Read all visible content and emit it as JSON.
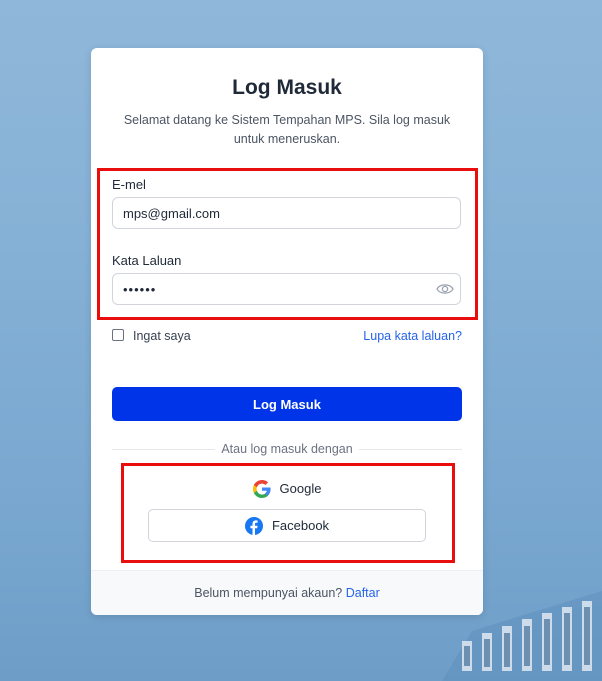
{
  "login": {
    "title": "Log Masuk",
    "subtitle": "Selamat datang ke Sistem Tempahan MPS. Sila log masuk untuk meneruskan.",
    "email_label": "E-mel",
    "email_value": "mps@gmail.com",
    "password_label": "Kata Laluan",
    "password_value": "••••••",
    "remember_label": "Ingat saya",
    "forgot_link": "Lupa kata laluan?",
    "submit_label": "Log Masuk",
    "divider_text": "Atau log masuk dengan",
    "google_label": "Google",
    "facebook_label": "Facebook",
    "footer_text": "Belum mempunyai akaun?",
    "register_link": "Daftar"
  },
  "colors": {
    "primary": "#0034e8",
    "link": "#2563eb",
    "highlight": "#e80e0e",
    "facebook": "#1877f2"
  },
  "icons": [
    "eye-icon",
    "google-icon",
    "facebook-icon"
  ]
}
